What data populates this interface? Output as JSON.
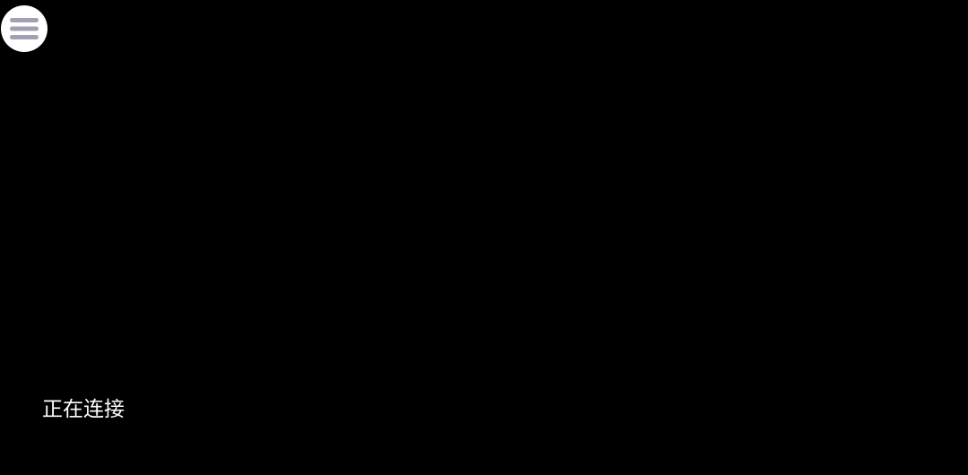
{
  "menu": {
    "icon": "hamburger-menu-icon",
    "background_color": "#ffffff",
    "icon_color": "#a3a0b4"
  },
  "status": {
    "text": "正在连接",
    "color": "#ffffff"
  },
  "screen": {
    "background_color": "#000000"
  }
}
